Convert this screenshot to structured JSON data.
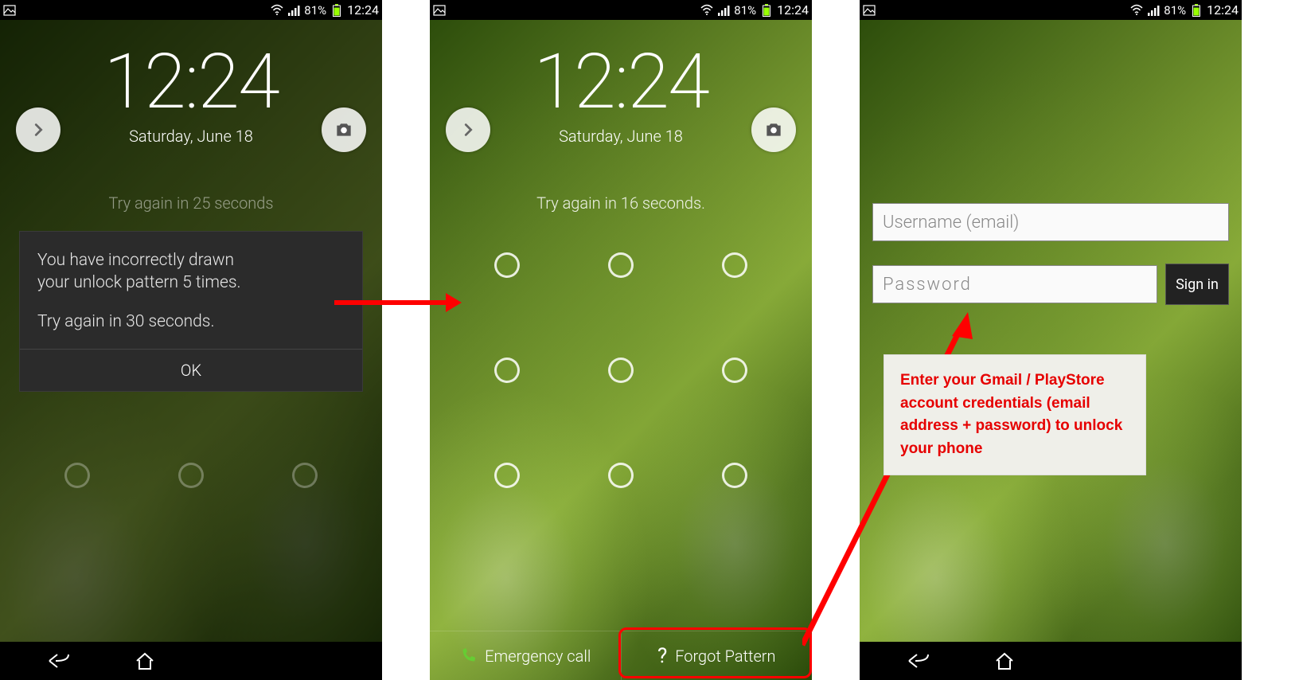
{
  "status": {
    "battery_pct": "81%",
    "time": "12:24"
  },
  "lock": {
    "time": "12:24",
    "date": "Saturday, June 18"
  },
  "screen1": {
    "try_text_behind": "Try again in 25 seconds",
    "dialog": {
      "line1": "You have incorrectly drawn",
      "line2": "your unlock pattern 5 times.",
      "line3": "Try again in 30 seconds.",
      "ok": "OK"
    }
  },
  "screen2": {
    "try_text": "Try again in 16 seconds.",
    "emergency": "Emergency call",
    "forgot": "Forgot Pattern"
  },
  "screen3": {
    "username_placeholder": "Username (email)",
    "password_placeholder": "Password",
    "signin": "Sign in"
  },
  "annotation": {
    "text": "Enter your Gmail / PlayStore account credentials (email address + password) to unlock your phone"
  }
}
